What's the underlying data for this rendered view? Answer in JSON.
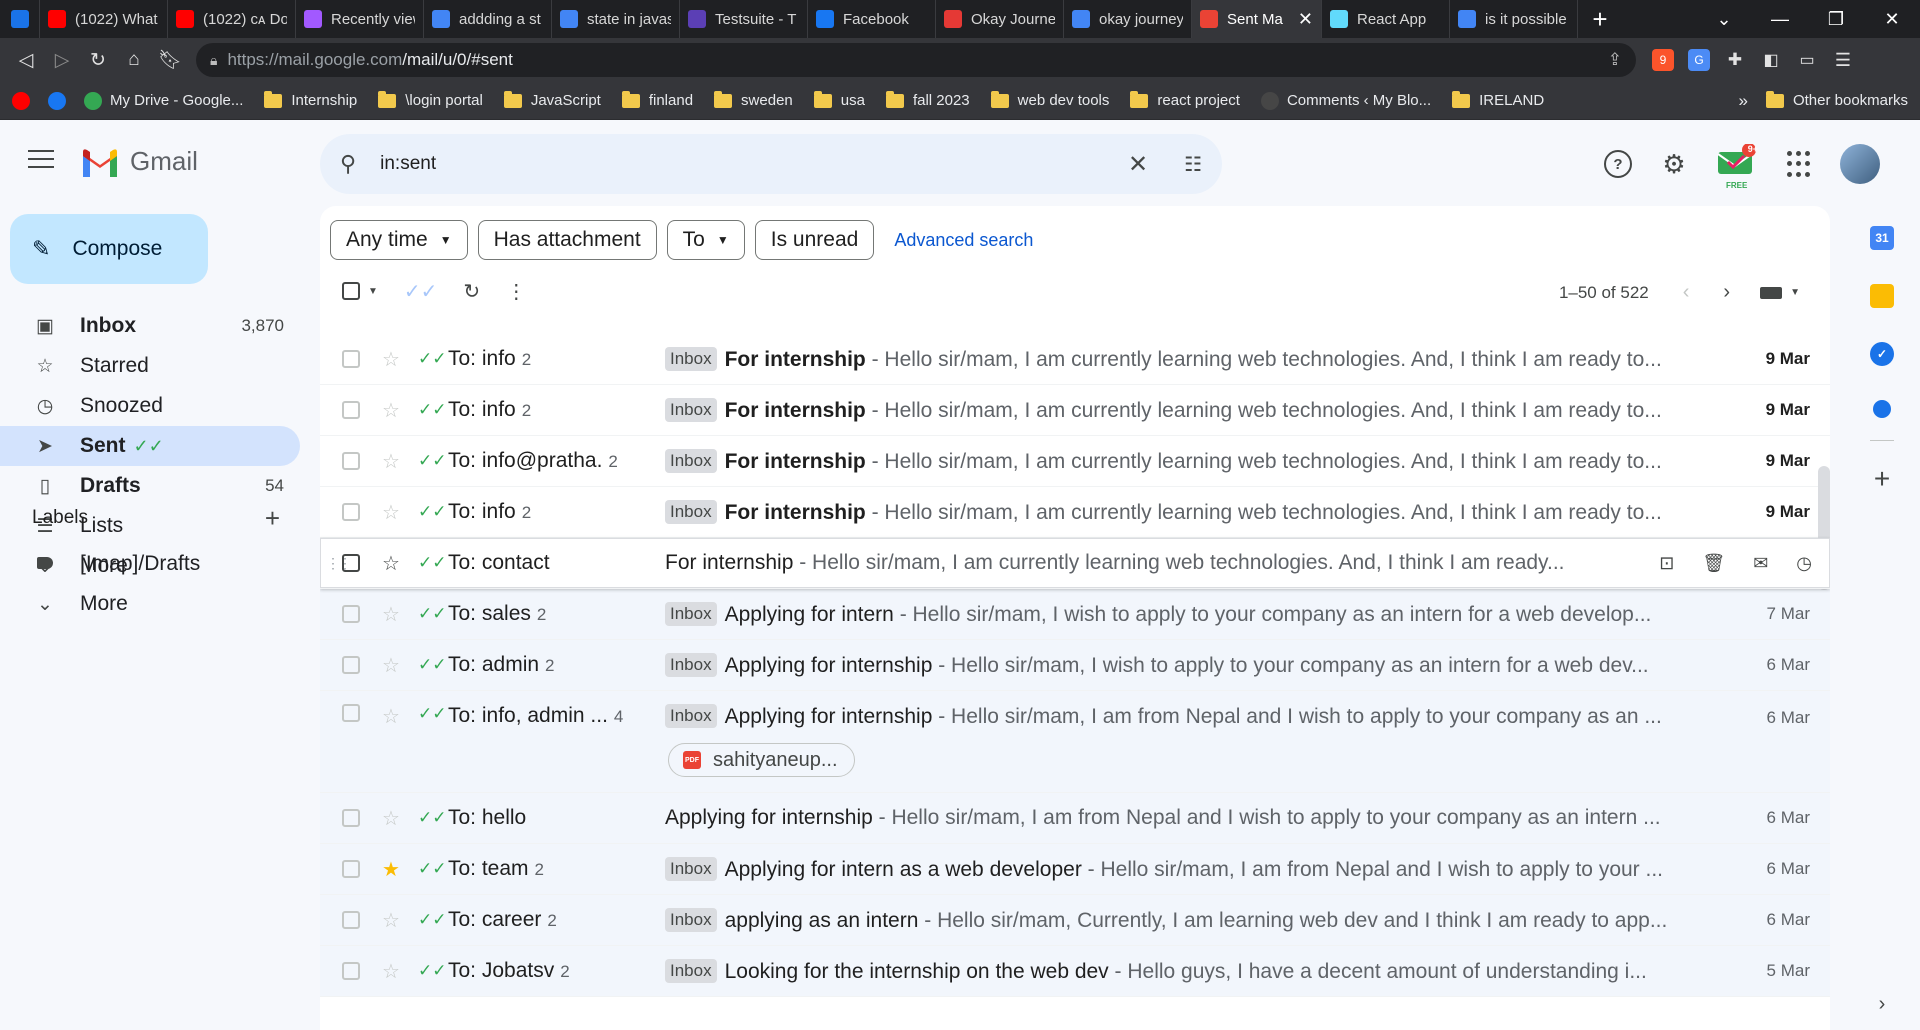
{
  "browser": {
    "tabs": [
      {
        "title": "",
        "favicon_color": "#1a73e8",
        "pinned": true,
        "icon": "gem-icon"
      },
      {
        "title": "(1022) What",
        "favicon_color": "#ff0000",
        "icon": "youtube-icon"
      },
      {
        "title": "(1022) ᴄᴀ Do",
        "favicon_color": "#ff0000",
        "icon": "youtube-icon"
      },
      {
        "title": "Recently view",
        "favicon_color": "#a259ff",
        "icon": "figma-icon"
      },
      {
        "title": "addding a st",
        "favicon_color": "#4285f4",
        "icon": "google-icon"
      },
      {
        "title": "state in javas",
        "favicon_color": "#4285f4",
        "icon": "google-icon"
      },
      {
        "title": "Testsuite - T",
        "favicon_color": "#5b3fb5",
        "icon": "chart-icon"
      },
      {
        "title": "Facebook",
        "favicon_color": "#1877f2",
        "icon": "facebook-icon"
      },
      {
        "title": "Okay Journe",
        "favicon_color": "#e53935",
        "icon": "journal-icon"
      },
      {
        "title": "okay journey",
        "favicon_color": "#4285f4",
        "icon": "google-icon"
      },
      {
        "title": "Sent Ma",
        "favicon_color": "#ea4335",
        "icon": "gmail-icon",
        "active": true
      },
      {
        "title": "React App",
        "favicon_color": "#61dafb",
        "icon": "react-icon"
      },
      {
        "title": "is it possible",
        "favicon_color": "#4285f4",
        "icon": "google-icon"
      }
    ],
    "url_host": "https://mail.google.com",
    "url_path": "/mail/u/0/#sent",
    "bookmarks": [
      {
        "label": "",
        "type": "icon",
        "color": "#ff0000",
        "icon": "youtube-icon"
      },
      {
        "label": "",
        "type": "icon",
        "color": "#1877f2",
        "icon": "facebook-icon"
      },
      {
        "label": "My Drive - Google...",
        "type": "icon",
        "color": "#34a853",
        "icon": "drive-icon"
      },
      {
        "label": "Internship",
        "type": "folder"
      },
      {
        "label": "\\login portal",
        "type": "folder"
      },
      {
        "label": "JavaScript",
        "type": "folder"
      },
      {
        "label": "finland",
        "type": "folder"
      },
      {
        "label": "sweden",
        "type": "folder"
      },
      {
        "label": "usa",
        "type": "folder"
      },
      {
        "label": "fall 2023",
        "type": "folder"
      },
      {
        "label": "web dev tools",
        "type": "folder"
      },
      {
        "label": "react project",
        "type": "folder"
      },
      {
        "label": "Comments ‹ My Blo...",
        "type": "icon",
        "color": "#464646",
        "icon": "wordpress-icon"
      },
      {
        "label": "IRELAND",
        "type": "folder"
      }
    ],
    "bookmarks_more": "»",
    "other_bookmarks": "Other bookmarks"
  },
  "gmail": {
    "logo_text": "Gmail",
    "search_value": "in:sent",
    "compose_label": "Compose",
    "nav": [
      {
        "label": "Inbox",
        "count": "3,870",
        "icon": "inbox-icon",
        "bold": true
      },
      {
        "label": "Starred",
        "count": "",
        "icon": "star-icon"
      },
      {
        "label": "Snoozed",
        "count": "",
        "icon": "clock-icon"
      },
      {
        "label": "Sent",
        "count": "",
        "icon": "send-icon",
        "active": true
      },
      {
        "label": "Drafts",
        "count": "54",
        "icon": "draft-icon",
        "bold": true
      },
      {
        "label": "Lists",
        "count": "",
        "icon": "list-icon"
      },
      {
        "label": "More",
        "count": "",
        "icon": "chevron-down-icon"
      }
    ],
    "labels_title": "Labels",
    "labels": [
      {
        "label": "[Imap]/Drafts",
        "icon": "label-icon"
      },
      {
        "label": "More",
        "icon": "chevron-down-icon"
      }
    ],
    "filters": {
      "any_time": "Any time",
      "has_attachment": "Has attachment",
      "to": "To",
      "is_unread": "Is unread",
      "advanced": "Advanced search"
    },
    "pagination": "1–50 of 522",
    "free_badge": "FREE",
    "notif_badge": "9+",
    "emails": [
      {
        "to": "To: info",
        "count": "2",
        "label": "Inbox",
        "subject": "For internship",
        "snippet": " - Hello sir/mam, I am currently learning web technologies. And, I think I am ready to...",
        "date": "9 Mar",
        "unread": true
      },
      {
        "to": "To: info",
        "count": "2",
        "label": "Inbox",
        "subject": "For internship",
        "snippet": " - Hello sir/mam, I am currently learning web technologies. And, I think I am ready to...",
        "date": "9 Mar",
        "unread": true
      },
      {
        "to": "To: info@pratha.",
        "count": "2",
        "label": "Inbox",
        "subject": "For internship",
        "snippet": " - Hello sir/mam, I am currently learning web technologies. And, I think I am ready to...",
        "date": "9 Mar",
        "unread": true
      },
      {
        "to": "To: info",
        "count": "2",
        "label": "Inbox",
        "subject": "For internship",
        "snippet": " - Hello sir/mam, I am currently learning web technologies. And, I think I am ready to...",
        "date": "9 Mar",
        "unread": true
      },
      {
        "to": "To: contact",
        "count": "",
        "label": "",
        "subject": "For internship",
        "snippet": " - Hello sir/mam, I am currently learning web technologies. And, I think I am ready...",
        "date": "",
        "hover": true
      },
      {
        "to": "To: sales",
        "count": "2",
        "label": "Inbox",
        "subject": "Applying for intern",
        "snippet": " - Hello sir/mam, I wish to apply to your company as an intern for a web develop...",
        "date": "7 Mar"
      },
      {
        "to": "To: admin",
        "count": "2",
        "label": "Inbox",
        "subject": "Applying for internship",
        "snippet": " - Hello sir/mam, I wish to apply to your company as an intern for a web dev...",
        "date": "6 Mar"
      },
      {
        "to": "To: info, admin ...",
        "count": "4",
        "label": "Inbox",
        "subject": "Applying for internship",
        "snippet": " - Hello sir/mam, I am from Nepal and I wish to apply to your company as an ...",
        "date": "6 Mar",
        "attachment": "sahityaneup..."
      },
      {
        "to": "To: hello",
        "count": "",
        "label": "",
        "subject": "Applying for internship",
        "snippet": " - Hello sir/mam, I am from Nepal and I wish to apply to your company as an intern ...",
        "date": "6 Mar"
      },
      {
        "to": "To: team",
        "count": "2",
        "label": "Inbox",
        "subject": "Applying for intern as a web developer",
        "snippet": " - Hello sir/mam, I am from Nepal and I wish to apply to your ...",
        "date": "6 Mar",
        "starred": true
      },
      {
        "to": "To: career",
        "count": "2",
        "label": "Inbox",
        "subject": "applying as an intern",
        "snippet": " - Hello sir/mam, Currently, I am learning web dev and I think I am ready to app...",
        "date": "6 Mar"
      },
      {
        "to": "To: Jobatsv",
        "count": "2",
        "label": "Inbox",
        "subject": "Looking for the internship on the web dev",
        "snippet": " - Hello guys, I have a decent amount of understanding i...",
        "date": "5 Mar"
      }
    ],
    "side_panel": [
      {
        "icon": "calendar-icon",
        "color": "#4285f4",
        "text": "31"
      },
      {
        "icon": "keep-icon",
        "color": "#fbbc04",
        "text": ""
      },
      {
        "icon": "tasks-icon",
        "color": "#1a73e8",
        "text": "✓"
      },
      {
        "icon": "contacts-icon",
        "color": "#1a73e8",
        "text": ""
      }
    ]
  }
}
